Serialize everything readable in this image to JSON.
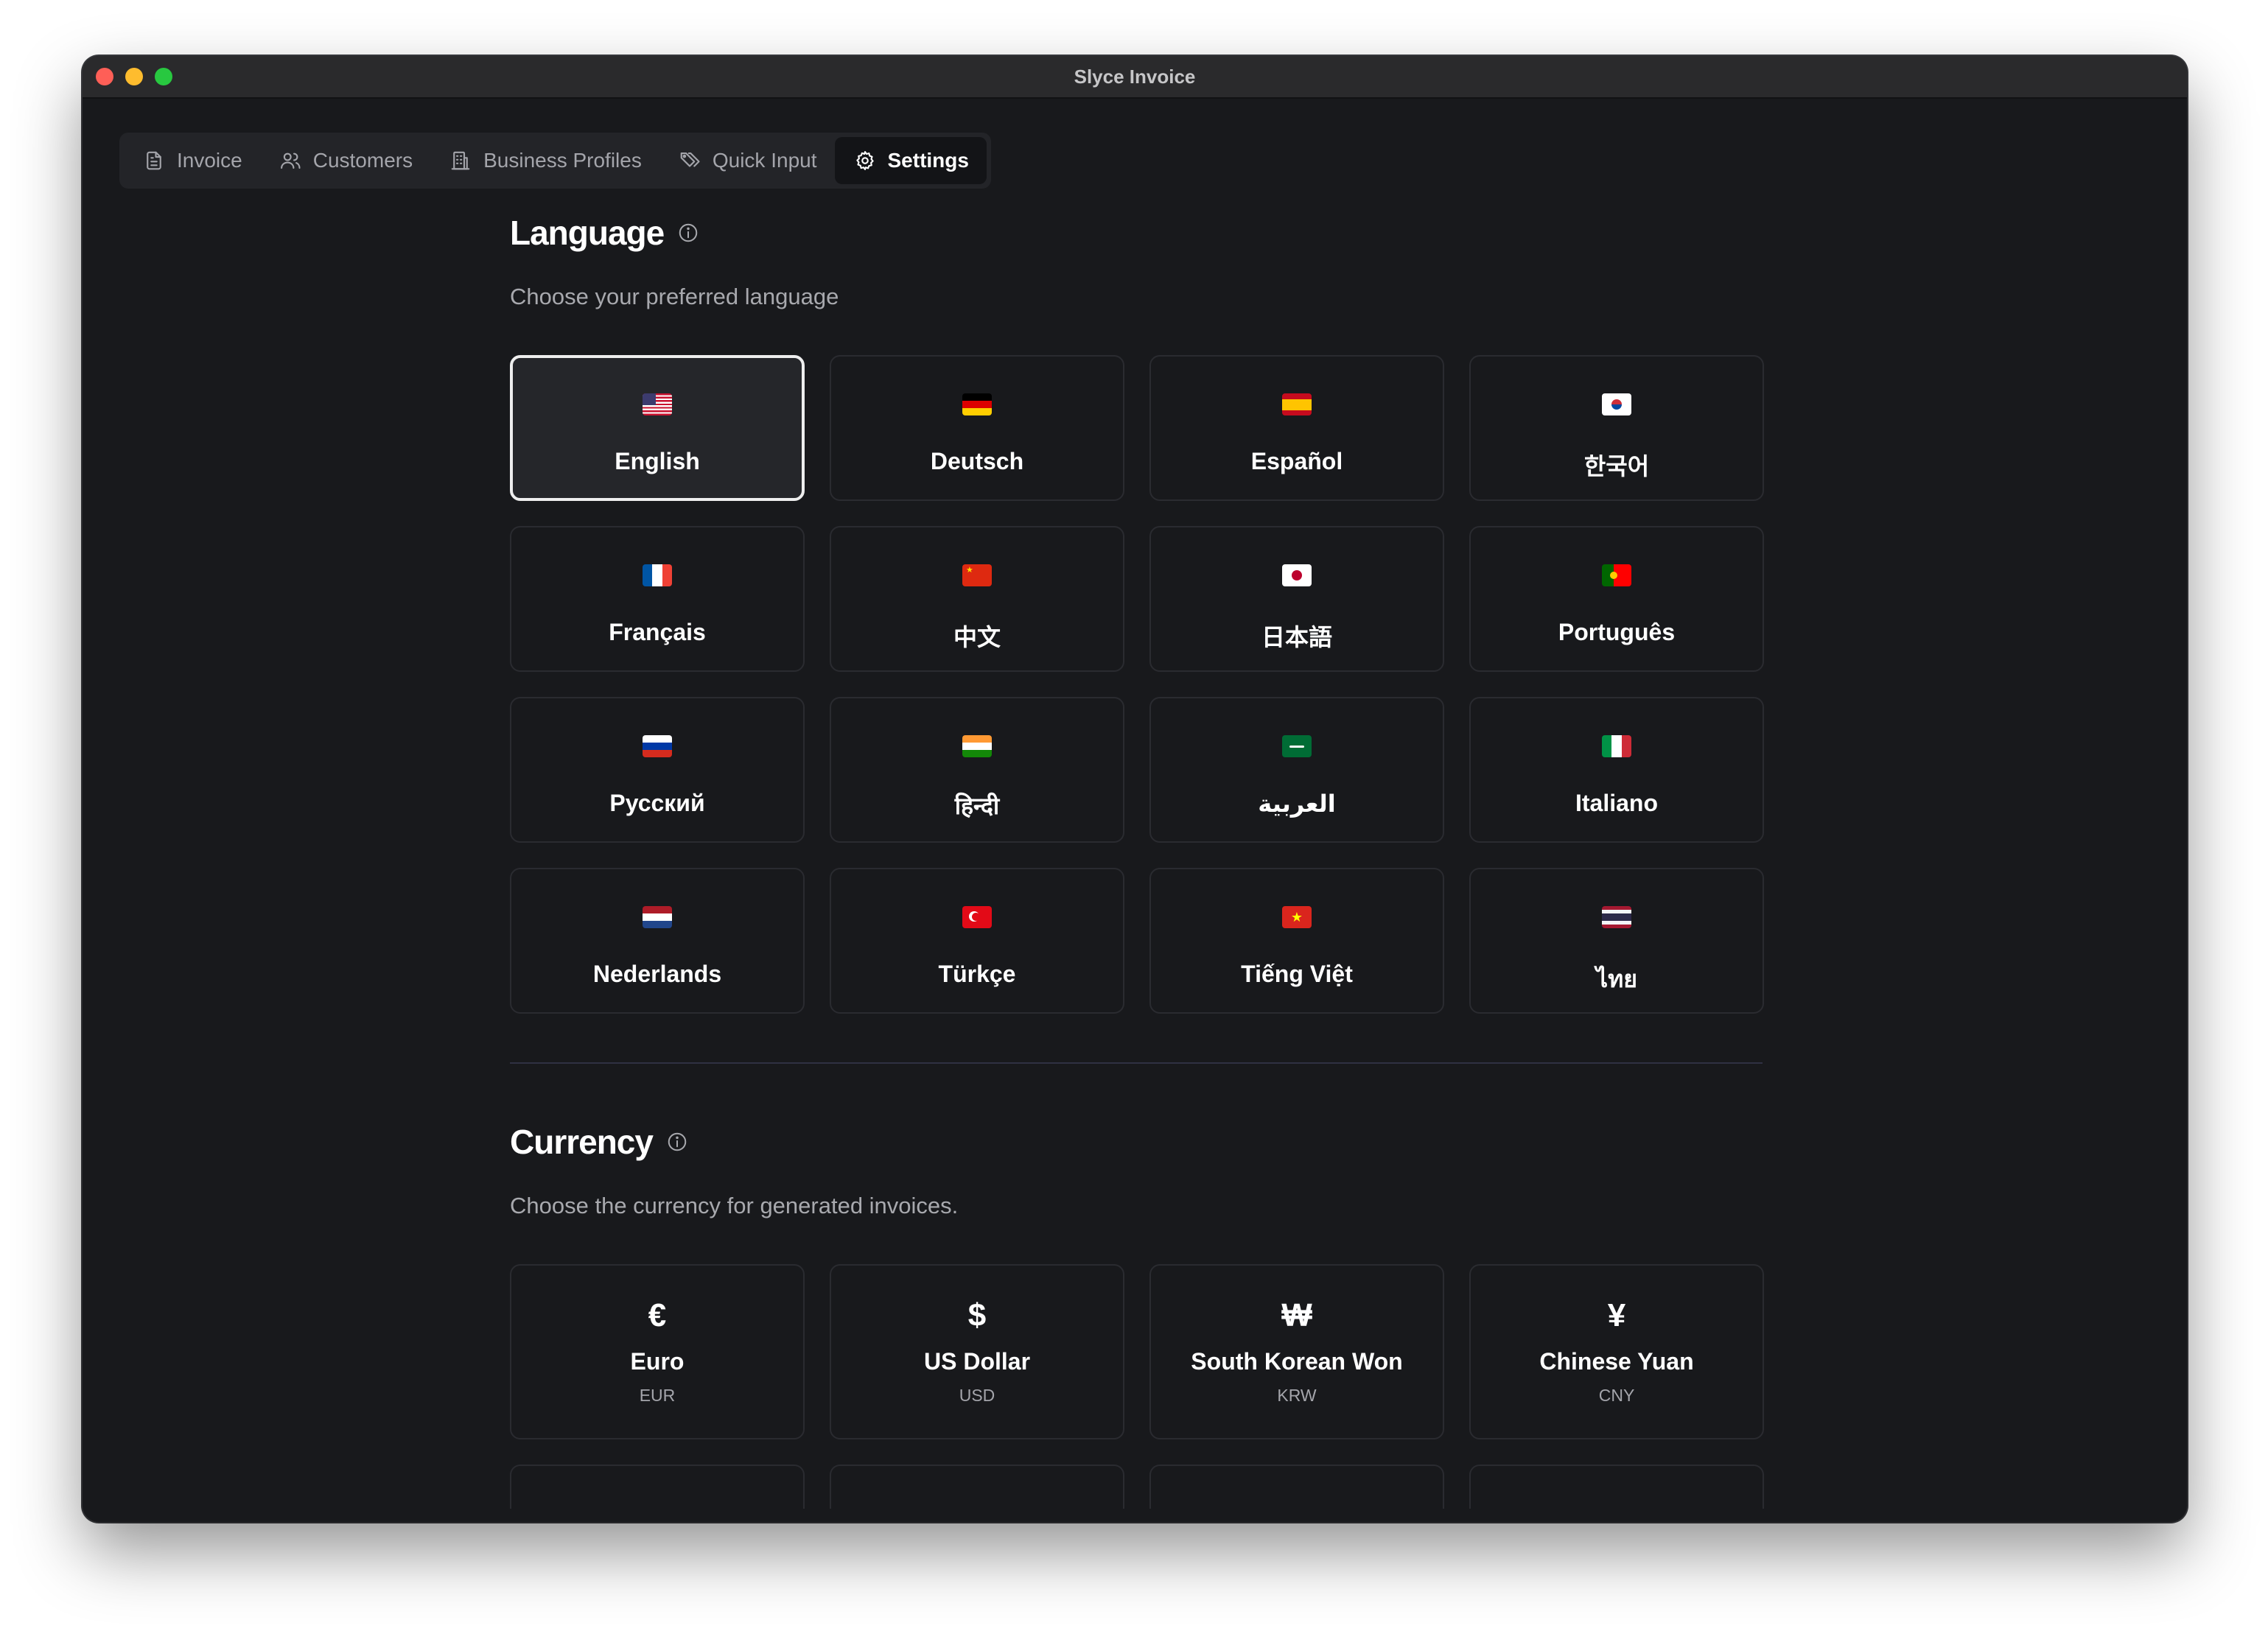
{
  "window": {
    "title": "Slyce Invoice"
  },
  "tabs": [
    {
      "label": "Invoice",
      "icon": "document-icon",
      "active": false
    },
    {
      "label": "Customers",
      "icon": "users-icon",
      "active": false
    },
    {
      "label": "Business Profiles",
      "icon": "building-icon",
      "active": false
    },
    {
      "label": "Quick Input",
      "icon": "tags-icon",
      "active": false
    },
    {
      "label": "Settings",
      "icon": "gear-icon",
      "active": true
    }
  ],
  "language": {
    "title": "Language",
    "description": "Choose your preferred language",
    "selected": "English",
    "options": [
      {
        "label": "English",
        "flag": "flag-us"
      },
      {
        "label": "Deutsch",
        "flag": "flag-de"
      },
      {
        "label": "Español",
        "flag": "flag-es"
      },
      {
        "label": "한국어",
        "flag": "flag-kr"
      },
      {
        "label": "Français",
        "flag": "flag-fr"
      },
      {
        "label": "中文",
        "flag": "flag-cn"
      },
      {
        "label": "日本語",
        "flag": "flag-jp"
      },
      {
        "label": "Português",
        "flag": "flag-pt"
      },
      {
        "label": "Русский",
        "flag": "flag-ru"
      },
      {
        "label": "हिन्दी",
        "flag": "flag-in"
      },
      {
        "label": "العربية",
        "flag": "flag-sa"
      },
      {
        "label": "Italiano",
        "flag": "flag-it"
      },
      {
        "label": "Nederlands",
        "flag": "flag-nl"
      },
      {
        "label": "Türkçe",
        "flag": "flag-tr"
      },
      {
        "label": "Tiếng Việt",
        "flag": "flag-vn"
      },
      {
        "label": "ไทย",
        "flag": "flag-th"
      }
    ]
  },
  "currency": {
    "title": "Currency",
    "description": "Choose the currency for generated invoices.",
    "options": [
      {
        "symbol": "€",
        "name": "Euro",
        "code": "EUR"
      },
      {
        "symbol": "$",
        "name": "US Dollar",
        "code": "USD"
      },
      {
        "symbol": "₩",
        "name": "South Korean Won",
        "code": "KRW"
      },
      {
        "symbol": "¥",
        "name": "Chinese Yuan",
        "code": "CNY"
      }
    ]
  },
  "colors": {
    "background": "#18191c",
    "card_border": "#2a2b30",
    "selected_border": "#eeeeee",
    "text_primary": "#ffffff",
    "text_secondary": "#a8a9ae"
  }
}
